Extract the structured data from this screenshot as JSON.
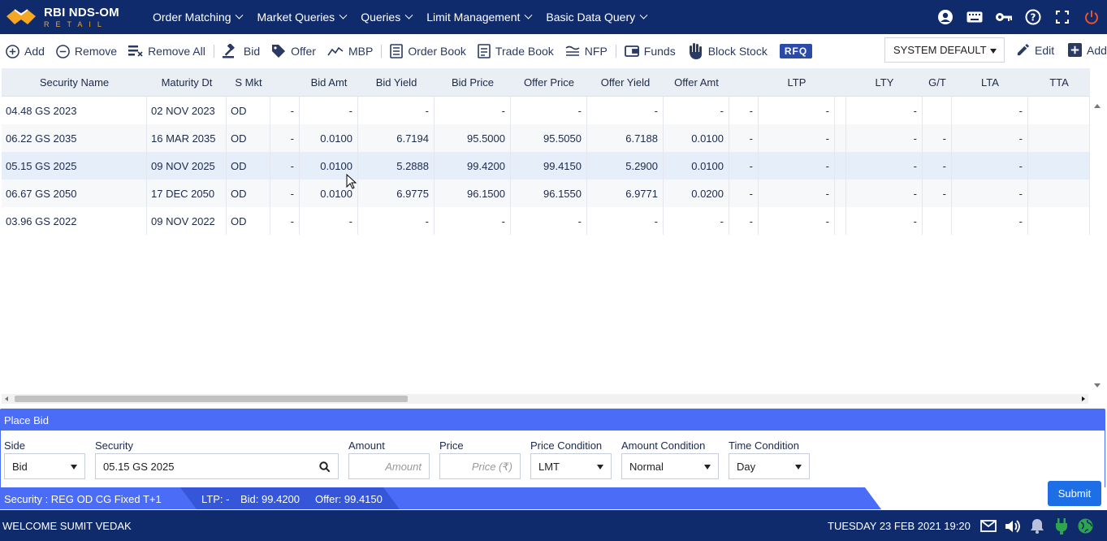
{
  "app": {
    "title": "RBI NDS-OM",
    "subtitle": "RETAIL"
  },
  "menu": [
    {
      "label": "Order Matching"
    },
    {
      "label": "Market Queries"
    },
    {
      "label": "Queries"
    },
    {
      "label": "Limit Management"
    },
    {
      "label": "Basic Data Query"
    }
  ],
  "toolbar": {
    "add": "Add",
    "remove": "Remove",
    "remove_all": "Remove All",
    "bid": "Bid",
    "offer": "Offer",
    "mbp": "MBP",
    "order_book": "Order Book",
    "trade_book": "Trade Book",
    "nfp": "NFP",
    "funds": "Funds",
    "block_stock": "Block Stock",
    "rfq": "RFQ",
    "view_select": "SYSTEM DEFAULT",
    "edit": "Edit",
    "add2": "Add"
  },
  "grid": {
    "columns": [
      "Security Name",
      "Maturity Dt",
      "S Mkt",
      "",
      "Bid Amt",
      "Bid Yield",
      "Bid Price",
      "Offer Price",
      "Offer Yield",
      "Offer Amt",
      "",
      "LTP",
      "",
      "LTY",
      "G/T",
      "LTA",
      "TTA"
    ],
    "rows": [
      [
        "04.48 GS 2023",
        "02 NOV 2023",
        "OD",
        "-",
        "-",
        "-",
        "-",
        "-",
        "-",
        "-",
        "-",
        "-",
        "",
        "-",
        "",
        "-",
        ""
      ],
      [
        "06.22 GS 2035",
        "16 MAR 2035",
        "OD",
        "-",
        "0.0100",
        "6.7194",
        "95.5000",
        "95.5050",
        "6.7188",
        "0.0100",
        "-",
        "-",
        "",
        "-",
        "-",
        "-",
        ""
      ],
      [
        "05.15 GS 2025",
        "09 NOV 2025",
        "OD",
        "-",
        "0.0100",
        "5.2888",
        "99.4200",
        "99.4150",
        "5.2900",
        "0.0100",
        "-",
        "-",
        "",
        "-",
        "-",
        "-",
        ""
      ],
      [
        "06.67 GS 2050",
        "17 DEC 2050",
        "OD",
        "-",
        "0.0100",
        "6.9775",
        "96.1500",
        "96.1550",
        "6.9771",
        "0.0200",
        "-",
        "-",
        "",
        "-",
        "-",
        "-",
        ""
      ],
      [
        "03.96 GS 2022",
        "09 NOV 2022",
        "OD",
        "-",
        "-",
        "-",
        "-",
        "-",
        "-",
        "-",
        "-",
        "-",
        "",
        "-",
        "",
        "-",
        ""
      ]
    ]
  },
  "place_bid": {
    "title": "Place Bid",
    "side_label": "Side",
    "side_value": "Bid",
    "security_label": "Security",
    "security_value": "05.15 GS 2025",
    "amount_label": "Amount",
    "amount_placeholder": "Amount",
    "price_label": "Price",
    "price_placeholder": "Price (₹)",
    "price_condition_label": "Price Condition",
    "price_condition_value": "LMT",
    "amount_condition_label": "Amount Condition",
    "amount_condition_value": "Normal",
    "time_condition_label": "Time Condition",
    "time_condition_value": "Day",
    "submit": "Submit"
  },
  "info": {
    "security": "Security : REG OD CG Fixed T+1",
    "ltp": "LTP: -",
    "bid": "Bid: 99.4200",
    "offer": "Offer: 99.4150"
  },
  "footer": {
    "welcome": "WELCOME SUMIT VEDAK",
    "datetime": "TUESDAY 23 FEB 2021 19:20"
  },
  "colors": {
    "navy": "#102b6b",
    "accent": "#4a6cf7",
    "logo_orange": "#f5a623",
    "power_red": "#e8532b",
    "online_green": "#2ea44f"
  }
}
